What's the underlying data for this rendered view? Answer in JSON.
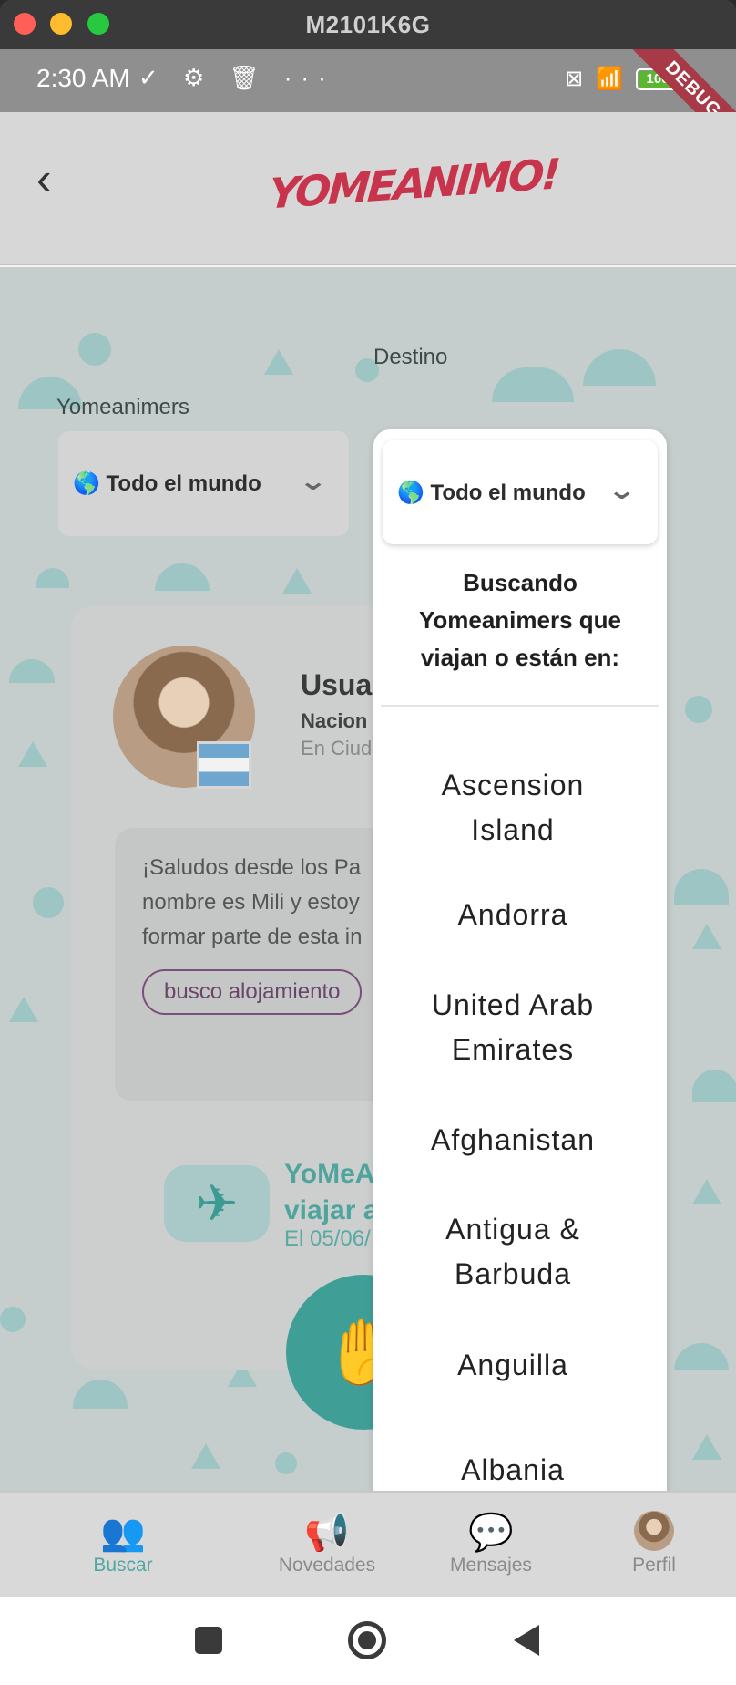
{
  "window": {
    "title": "M2101K6G"
  },
  "status_bar": {
    "time": "2:30 AM",
    "left_icons": "✓ ⚙ 🗑 ···",
    "wifi": "📶",
    "battery": "100",
    "debug": "DEBUG"
  },
  "header": {
    "logo_text": "YOMEANIMO!"
  },
  "filters": {
    "yomeanimers_label": "Yomeanimers",
    "yomeanimers_value": "🌎 Todo el mundo",
    "destino_label": "Destino",
    "destino_value": "🌎 Todo el mundo"
  },
  "profile_card": {
    "name": "Usua",
    "nationality": "Nacion",
    "city": "En Ciud",
    "message": "¡Saludos desde los Pa\nnombre es Mili y estoy\nformar parte de esta in",
    "tag": "busco alojamiento",
    "travel_title": "YoMeA\nviajar a",
    "travel_date": "El 05/06/"
  },
  "dropdown": {
    "selected": "🌎 Todo el mundo",
    "header": "Buscando Yomeanimers que viajan o están en:",
    "options": [
      "Ascension Island",
      "Andorra",
      "United Arab Emirates",
      "Afghanistan",
      "Antigua & Barbuda",
      "Anguilla",
      "Albania"
    ]
  },
  "bottom_nav": [
    {
      "label": "Buscar",
      "icon": "people-icon",
      "active": true
    },
    {
      "label": "Novedades",
      "icon": "megaphone-icon",
      "active": false
    },
    {
      "label": "Mensajes",
      "icon": "chat-icon",
      "active": false
    },
    {
      "label": "Perfil",
      "icon": "avatar",
      "active": false
    }
  ],
  "colors": {
    "brand": "#c9344d",
    "accent": "#4ea7a0",
    "pattern": "#8fc2c0"
  }
}
